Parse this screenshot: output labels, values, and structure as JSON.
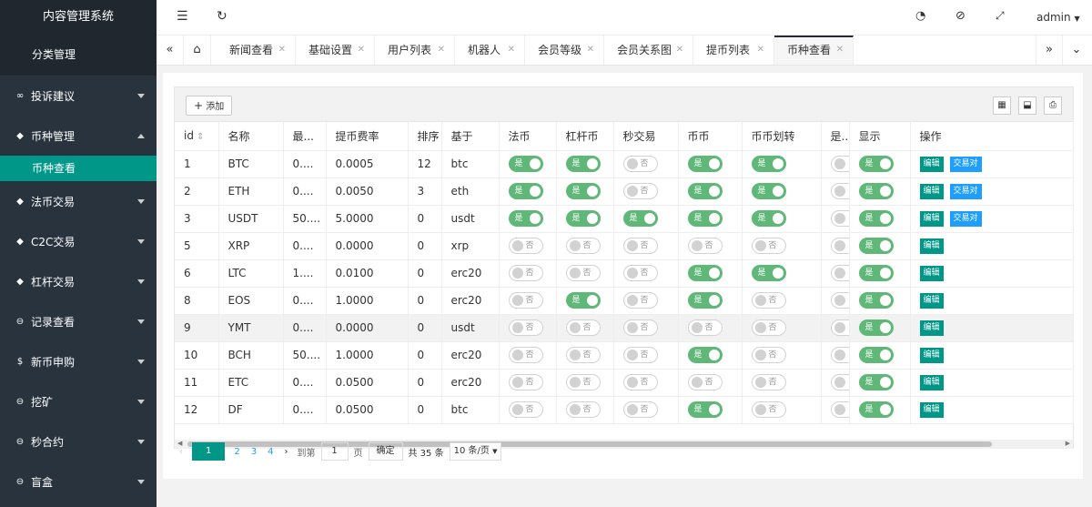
{
  "app": {
    "title": "内容管理系统",
    "sub_item": "分类管理"
  },
  "sidebar": {
    "items": [
      {
        "label": "投诉建议",
        "icon": "link-icon",
        "expanded": false
      },
      {
        "label": "币种管理",
        "icon": "diamond-icon",
        "expanded": true
      },
      {
        "label": "法币交易",
        "icon": "diamond-icon",
        "expanded": false
      },
      {
        "label": "C2C交易",
        "icon": "diamond-icon",
        "expanded": false
      },
      {
        "label": "杠杆交易",
        "icon": "diamond-icon",
        "expanded": false
      },
      {
        "label": "记录查看",
        "icon": "coin-icon",
        "expanded": false
      },
      {
        "label": "新币申购",
        "icon": "dollar-icon",
        "expanded": false
      },
      {
        "label": "挖矿",
        "icon": "coin-icon",
        "expanded": false
      },
      {
        "label": "秒合约",
        "icon": "coin-icon",
        "expanded": false
      },
      {
        "label": "盲盒",
        "icon": "coin-icon",
        "expanded": false
      }
    ],
    "active_child": "币种查看"
  },
  "topbar": {
    "user": "admin"
  },
  "tabs": [
    "新闻查看",
    "基础设置",
    "用户列表",
    "机器人",
    "会员等级",
    "会员关系图",
    "提币列表",
    "币种查看"
  ],
  "active_tab": "币种查看",
  "toolbar": {
    "add_label": "添加"
  },
  "table": {
    "columns": [
      "id",
      "名称",
      "最...",
      "提币费率",
      "排序",
      "基于",
      "法币",
      "杠杆币",
      "秒交易",
      "币币",
      "币币划转",
      "是...",
      "显示",
      "操作"
    ],
    "on_label": "是",
    "off_label": "否",
    "edit_label": "编辑",
    "pair_label": "交易对",
    "rows": [
      {
        "id": "1",
        "name": "BTC",
        "min": "0....",
        "fee": "0.0005",
        "sort": "12",
        "base": "btc",
        "fabi": true,
        "ganggan": true,
        "miao": false,
        "bibi": true,
        "huazhuan": true,
        "shi": false,
        "show": true,
        "pair": true
      },
      {
        "id": "2",
        "name": "ETH",
        "min": "0....",
        "fee": "0.0050",
        "sort": "3",
        "base": "eth",
        "fabi": true,
        "ganggan": true,
        "miao": false,
        "bibi": true,
        "huazhuan": true,
        "shi": false,
        "show": true,
        "pair": true
      },
      {
        "id": "3",
        "name": "USDT",
        "min": "50....",
        "fee": "5.0000",
        "sort": "0",
        "base": "usdt",
        "fabi": true,
        "ganggan": true,
        "miao": true,
        "bibi": true,
        "huazhuan": true,
        "shi": false,
        "show": true,
        "pair": true
      },
      {
        "id": "5",
        "name": "XRP",
        "min": "0....",
        "fee": "0.0000",
        "sort": "0",
        "base": "xrp",
        "fabi": false,
        "ganggan": false,
        "miao": false,
        "bibi": false,
        "huazhuan": false,
        "shi": false,
        "show": true,
        "pair": false
      },
      {
        "id": "6",
        "name": "LTC",
        "min": "1....",
        "fee": "0.0100",
        "sort": "0",
        "base": "erc20",
        "fabi": false,
        "ganggan": false,
        "miao": false,
        "bibi": true,
        "huazhuan": true,
        "shi": false,
        "show": true,
        "pair": false
      },
      {
        "id": "8",
        "name": "EOS",
        "min": "0....",
        "fee": "1.0000",
        "sort": "0",
        "base": "erc20",
        "fabi": false,
        "ganggan": true,
        "miao": false,
        "bibi": true,
        "huazhuan": false,
        "shi": false,
        "show": true,
        "pair": false
      },
      {
        "id": "9",
        "name": "YMT",
        "min": "0....",
        "fee": "0.0000",
        "sort": "0",
        "base": "usdt",
        "fabi": false,
        "ganggan": false,
        "miao": false,
        "bibi": false,
        "huazhuan": false,
        "shi": false,
        "show": true,
        "pair": false
      },
      {
        "id": "10",
        "name": "BCH",
        "min": "50....",
        "fee": "1.0000",
        "sort": "0",
        "base": "erc20",
        "fabi": false,
        "ganggan": false,
        "miao": false,
        "bibi": true,
        "huazhuan": false,
        "shi": false,
        "show": true,
        "pair": false
      },
      {
        "id": "11",
        "name": "ETC",
        "min": "0....",
        "fee": "0.0500",
        "sort": "0",
        "base": "erc20",
        "fabi": false,
        "ganggan": false,
        "miao": false,
        "bibi": false,
        "huazhuan": false,
        "shi": false,
        "show": true,
        "pair": false
      },
      {
        "id": "12",
        "name": "DF",
        "min": "0....",
        "fee": "0.0500",
        "sort": "0",
        "base": "btc",
        "fabi": false,
        "ganggan": false,
        "miao": false,
        "bibi": true,
        "huazhuan": false,
        "shi": false,
        "show": true,
        "pair": false
      }
    ]
  },
  "pager": {
    "pages": [
      "1",
      "2",
      "3",
      "4"
    ],
    "current": "1",
    "goto_label": "到第",
    "goto_value": "1",
    "page_unit": "页",
    "confirm_label": "确定",
    "total_label": "共 35 条",
    "per_page": "10 条/页"
  },
  "colors": {
    "sidebar": "#28333e",
    "accent": "#009688",
    "switch_on": "#5fb878",
    "pair": "#1e9fff"
  }
}
